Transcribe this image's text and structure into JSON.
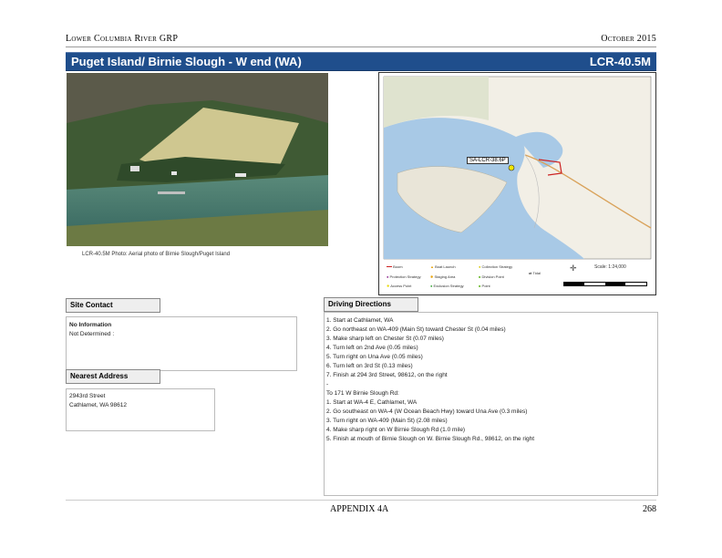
{
  "header": {
    "org": "Lower Columbia River GRP",
    "date": "October 2015"
  },
  "title": {
    "site_name": "Puget Island/ Birnie Slough - W end (WA)",
    "site_code": "LCR-40.5M"
  },
  "photo": {
    "caption": "LCR-40.5M Photo: Aerial photo of Birnie Slough/Puget Island"
  },
  "map": {
    "site_label": "SA-LCR-38.6P",
    "scale_label": "Scale: 1:24,000",
    "legend": [
      {
        "label": "Boom",
        "icon": "line-icon"
      },
      {
        "label": "Boat Launch",
        "icon": "triangle-icon"
      },
      {
        "label": "Collection Strategy",
        "icon": "circle-icon"
      },
      {
        "label": "Staging Area",
        "icon": "circle-icon"
      },
      {
        "label": "Protection Strategy",
        "icon": "circle-icon"
      },
      {
        "label": "Division Point",
        "icon": "square-icon"
      },
      {
        "label": "Access Point",
        "icon": "star-icon"
      },
      {
        "label": "Exclusion Strategy",
        "icon": "circle-icon"
      },
      {
        "label": "Point",
        "icon": "square-icon"
      },
      {
        "label": "Tidal",
        "icon": "arrow-icon"
      }
    ]
  },
  "site_contact": {
    "heading": "Site Contact",
    "name": "No Information",
    "phone": "Not Determined :"
  },
  "nearest_address": {
    "heading": "Nearest Address",
    "line1": "2943rd Street",
    "line2": "Cathlamet, WA  98612"
  },
  "driving_directions": {
    "heading": "Driving Directions",
    "lines": [
      "1. Start at Cathlamet, WA",
      "2. Go northeast on WA-409 (Main St) toward Chester St (0.04 miles)",
      "3. Make sharp left on Chester St (0.07 miles)",
      "4. Turn left on 2nd Ave (0.05 miles)",
      "5. Turn right on Una Ave (0.05 miles)",
      "6. Turn left on 3rd St (0.13 miles)",
      "7. Finish at 294 3rd Street, 98612, on the right",
      "-",
      "To 171 W Birnie Slough Rd:",
      "1. Start at WA-4 E, Cathlamet, WA",
      "2. Go southeast on WA-4 (W Ocean Beach Hwy) toward Una Ave (0.3 miles)",
      "3. Turn right on WA-409 (Main St) (2.08 miles)",
      "4. Make sharp right on W Birnie Slough Rd (1.0 mile)",
      "5. Finish at mouth of Birnie Slough on W. Birnie Slough Rd., 98612, on the right"
    ]
  },
  "footer": {
    "appendix": "APPENDIX 4A",
    "page": "268"
  },
  "colors": {
    "title_bar": "#1f4e8c",
    "river": "#a8c9e6",
    "land": "#f2efe6",
    "route": "#cc2222"
  }
}
